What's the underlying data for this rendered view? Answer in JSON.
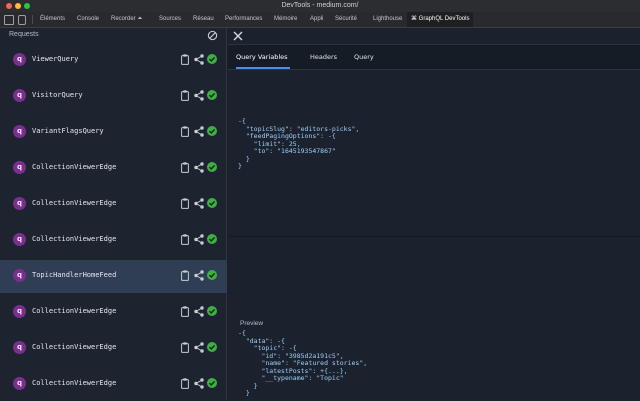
{
  "window": {
    "title": "DevTools - medium.com/"
  },
  "devtools_tabs": [
    "Éléments",
    "Console",
    "Recorder ⏶",
    "Sources",
    "Réseau",
    "Performances",
    "Mémoire",
    "Appli",
    "Sécurité",
    "Lighthouse",
    "⌘ GraphQL DevTools"
  ],
  "requests_panel": {
    "title": "Requests",
    "items": [
      {
        "badge": "q",
        "label": "ViewerQuery"
      },
      {
        "badge": "q",
        "label": "VisitorQuery"
      },
      {
        "badge": "q",
        "label": "VariantFlagsQuery"
      },
      {
        "badge": "q",
        "label": "CollectionViewerEdge"
      },
      {
        "badge": "q",
        "label": "CollectionViewerEdge"
      },
      {
        "badge": "q",
        "label": "CollectionViewerEdge"
      },
      {
        "badge": "q",
        "label": "TopicHandlerHomeFeed"
      },
      {
        "badge": "q",
        "label": "CollectionViewerEdge"
      },
      {
        "badge": "q",
        "label": "CollectionViewerEdge"
      },
      {
        "badge": "q",
        "label": "CollectionViewerEdge"
      }
    ],
    "selected_index": 6
  },
  "detail_tabs": [
    "Query Variables",
    "Headers",
    "Query"
  ],
  "active_detail_tab": "Query Variables",
  "query_variables": {
    "lines": [
      "-{",
      "  \"topicSlug\": \"editors-picks\",",
      "  \"feedPagingOptions\": -{",
      "    \"limit\": 25,",
      "    \"to\": \"1645193547867\"",
      "  }",
      "}"
    ]
  },
  "preview": {
    "label": "Preview",
    "lines": [
      "-{",
      "  \"data\": -{",
      "    \"topic\": -{",
      "      \"id\": \"3985d2a191c5\",",
      "      \"name\": \"Featured stories\",",
      "      \"latestPosts\": +{...},",
      "      \"__typename\": \"Topic\"",
      "    }",
      "  }"
    ]
  },
  "colors": {
    "badge": "#7a2f8e",
    "success": "#3cb043",
    "active_tab_underline": "#4a8cf0",
    "selected_row": "#2f3d55"
  },
  "icons": [
    "clear-icon",
    "close-icon",
    "clipboard-icon",
    "share-icon",
    "check-circle-icon",
    "inspect-icon",
    "device-icon"
  ]
}
